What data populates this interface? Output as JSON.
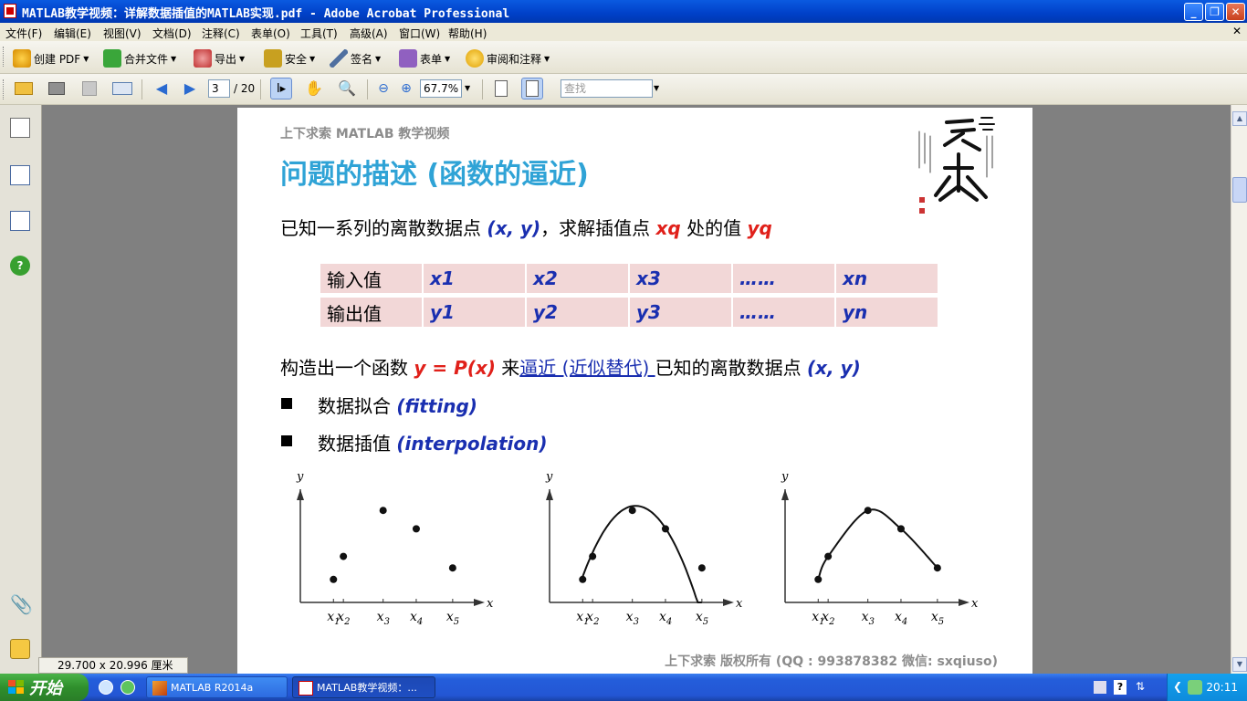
{
  "window": {
    "title": "MATLAB教学视频：详解数据插值的MATLAB实现.pdf - Adobe Acrobat Professional"
  },
  "menu": [
    "文件(F)",
    "编辑(E)",
    "视图(V)",
    "文档(D)",
    "注释(C)",
    "表单(O)",
    "工具(T)",
    "高级(A)",
    "窗口(W)",
    "帮助(H)"
  ],
  "toolbar1": {
    "create_pdf": "创建 PDF",
    "merge": "合并文件",
    "export": "导出",
    "security": "安全",
    "sign": "签名",
    "forms": "表单",
    "review": "审阅和注释"
  },
  "toolbar2": {
    "page_current": "3",
    "page_total": "/ 20",
    "zoom": "67.7%",
    "search_placeholder": "查找"
  },
  "page": {
    "header": "上下求索 MATLAB 教学视频",
    "title": "问题的描述 (函数的逼近)",
    "line1_pre": "已知一系列的离散数据点 ",
    "line1_xy": "(x, y)",
    "line1_mid": "，求解插值点 ",
    "line1_xq": "xq",
    "line1_mid2": " 处的值 ",
    "line1_yq": "yq",
    "table": {
      "rows": [
        {
          "label": "输入值",
          "values": [
            "x1",
            "x2",
            "x3",
            "……",
            "xn"
          ]
        },
        {
          "label": "输出值",
          "values": [
            "y1",
            "y2",
            "y3",
            "……",
            "yn"
          ]
        }
      ]
    },
    "line2_pre": "构造出一个函数 ",
    "line2_func": "y = P(x)",
    "line2_mid": " 来",
    "line2_link": "逼近 (近似替代) ",
    "line2_post": "已知的离散数据点 ",
    "line2_xy": "(x, y)",
    "bullet1_text": "数据拟合 ",
    "bullet1_term": "(fitting)",
    "bullet2_text": "数据插值 ",
    "bullet2_term": "(interpolation)",
    "plot_labels": {
      "y": "y",
      "x": "x",
      "ticks": [
        "x",
        "x",
        "x",
        "x",
        "x"
      ],
      "subs": [
        "1",
        "2",
        "3",
        "4",
        "5"
      ]
    },
    "footer": "上下求索  版权所有  (QQ : 993878382   微信: sxqiuso)"
  },
  "chart_data": [
    {
      "type": "scatter",
      "x": [
        1,
        1.3,
        2.5,
        3.5,
        4.6
      ],
      "y": [
        1,
        2,
        4,
        3.2,
        1.5
      ],
      "xlabel": "x",
      "ylabel": "y"
    },
    {
      "type": "scatter",
      "x": [
        1,
        1.3,
        2.5,
        3.5,
        4.6
      ],
      "y": [
        1,
        2,
        4,
        3.2,
        1.5
      ],
      "xlabel": "x",
      "ylabel": "y"
    },
    {
      "type": "line",
      "x": [
        1,
        1.3,
        2.5,
        3.5,
        4.6
      ],
      "y": [
        1,
        2,
        4,
        3.2,
        1.5
      ],
      "xlabel": "x",
      "ylabel": "y"
    }
  ],
  "status": {
    "page_size": "29.700 x 20.996 厘米"
  },
  "taskbar": {
    "start": "开始",
    "tasks": [
      "MATLAB R2014a",
      "MATLAB教学视频：..."
    ],
    "clock": "20:11"
  }
}
